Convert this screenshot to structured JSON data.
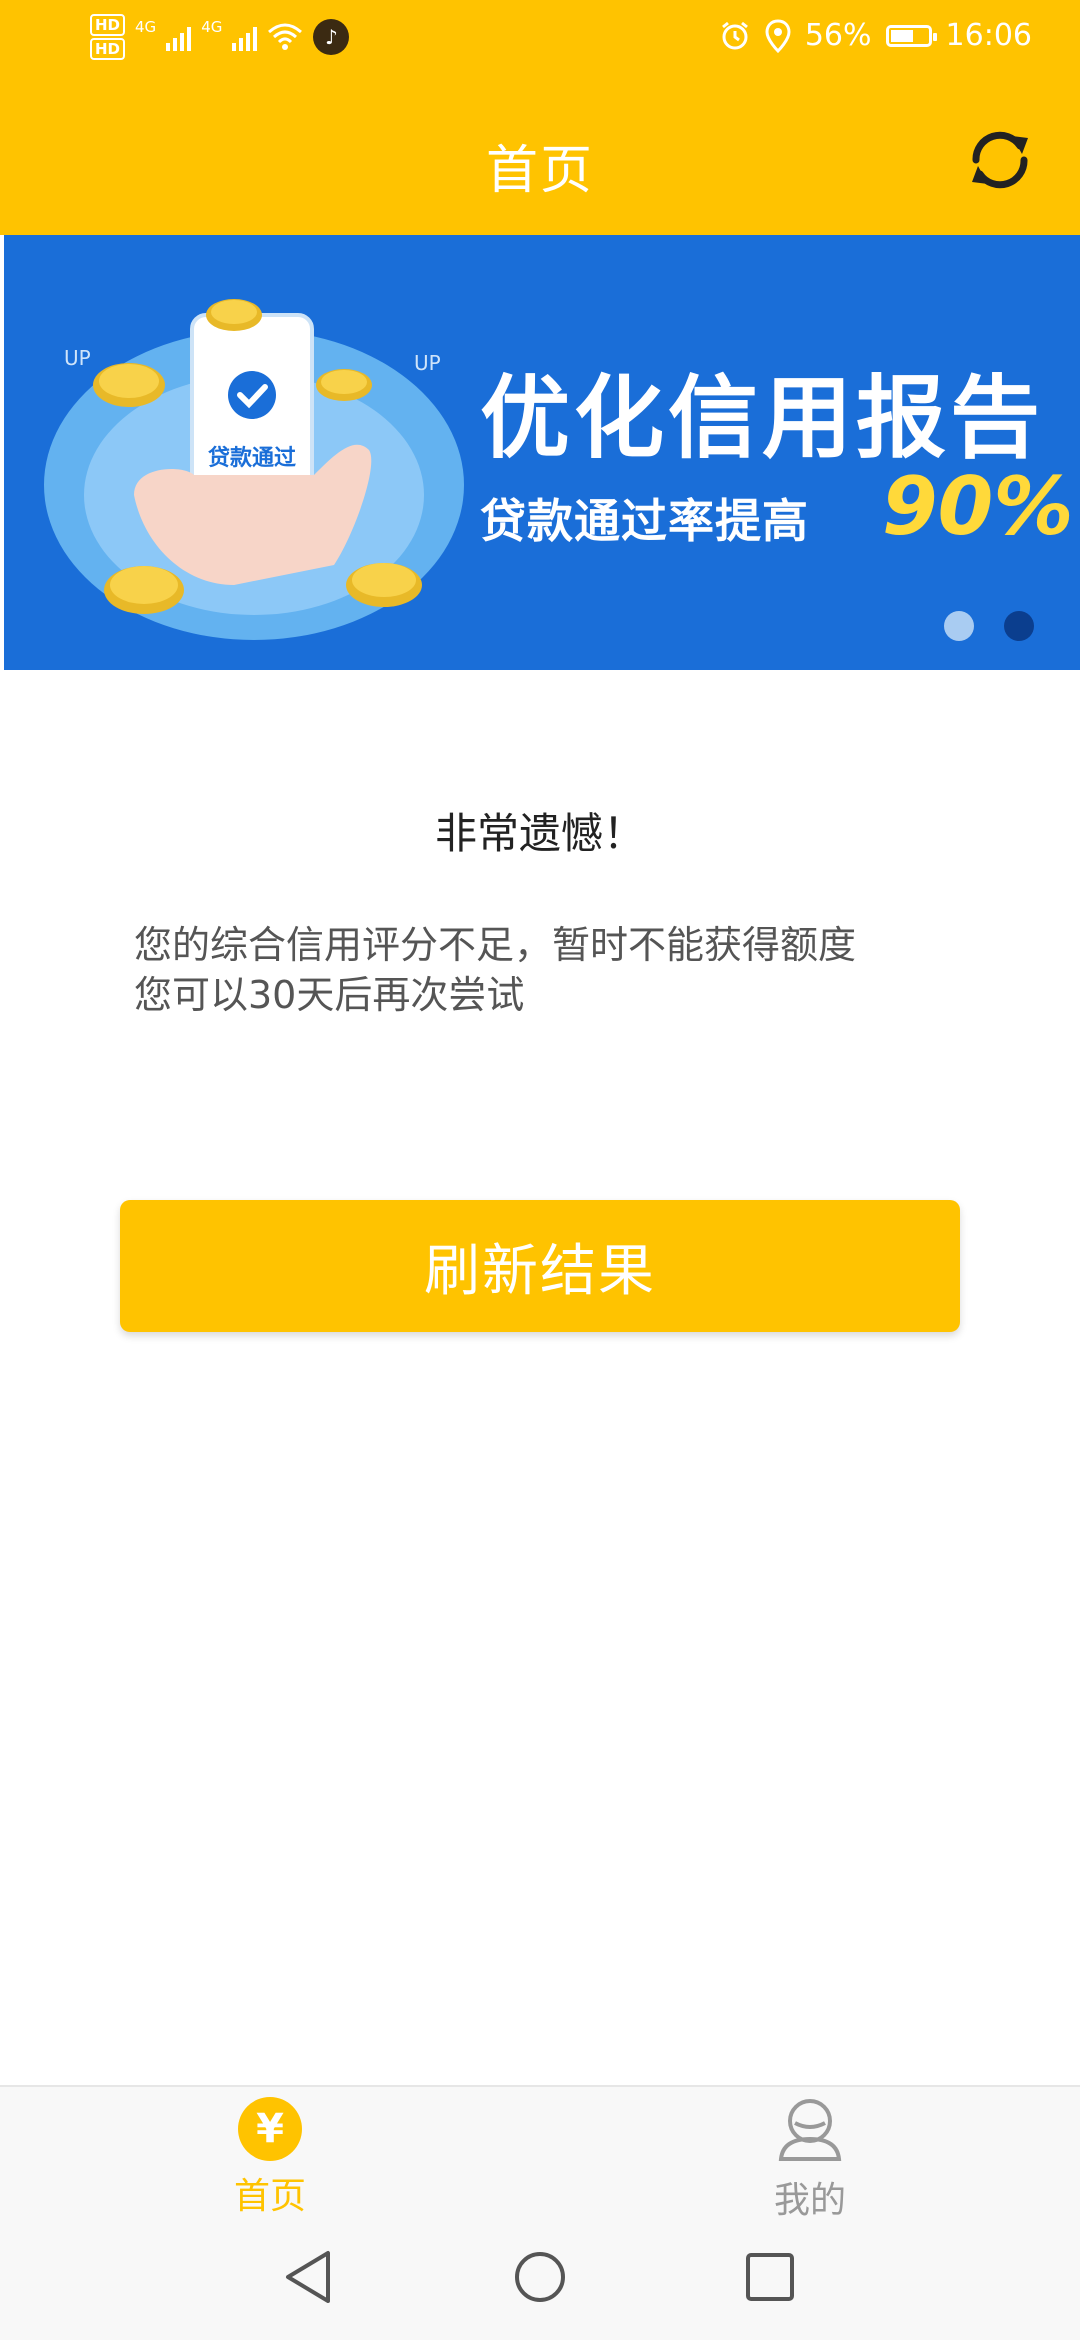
{
  "status_bar": {
    "hd1": "HD",
    "sim1": "1",
    "hd2": "HD",
    "sim2": "2",
    "net1": "4G",
    "net2": "4G",
    "battery_percent": "56%",
    "time": "16:06"
  },
  "header": {
    "title": "首页"
  },
  "banner": {
    "title": "优化信用报告",
    "subtitle": "贷款通过率提高",
    "percent": "90%",
    "phone_text": "贷款通过",
    "up_label_left": "UP",
    "up_label_right": "UP",
    "active_slide_index": 2,
    "slide_count": 2
  },
  "message": {
    "title": "非常遗憾！",
    "line1": "您的综合信用评分不足，暂时不能获得额度",
    "line2": "您可以30天后再次尝试"
  },
  "actions": {
    "refresh_label": "刷新结果"
  },
  "tabs": [
    {
      "label": "首页",
      "icon": "yen-icon",
      "active": true
    },
    {
      "label": "我的",
      "icon": "user-icon",
      "active": false
    }
  ],
  "colors": {
    "primary": "#FFC300",
    "banner_bg": "#1A6ED8",
    "banner_highlight": "#FFD93A",
    "inactive_tab": "#999999"
  }
}
